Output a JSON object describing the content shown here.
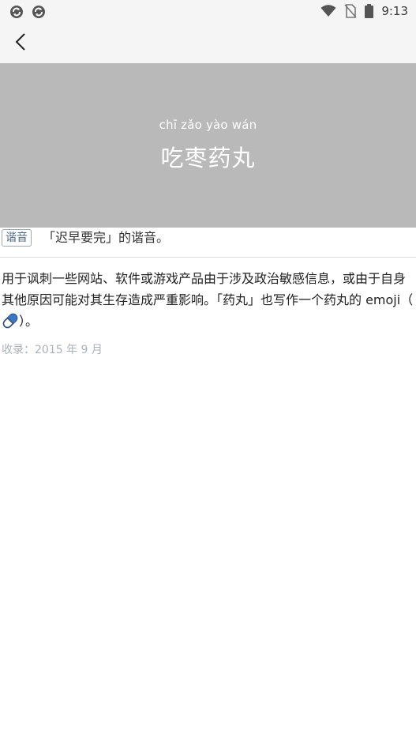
{
  "status_bar": {
    "time": "9:13",
    "left_icons": [
      "sync-icon",
      "sync-icon"
    ],
    "right_icons": [
      "wifi-icon",
      "no-sim-icon",
      "battery-icon"
    ]
  },
  "app_bar": {
    "back_icon": "back-arrow-icon"
  },
  "hero": {
    "pinyin": "chī zǎo yào wán",
    "title": "吃枣药丸",
    "background_color": "#b9b9b9"
  },
  "tag": {
    "badge": "谐音",
    "text": "「迟早要完」的谐音。"
  },
  "description": {
    "text_before": "用于讽刺一些网站、软件或游戏产品由于涉及政治敏感信息，或由于自身其他原因可能对其生存造成严重影响。「药丸」也写作一个药丸的 emoji（",
    "emoji_icon": "pill-icon",
    "text_after": "）。"
  },
  "record": "收录：2015 年 9 月"
}
